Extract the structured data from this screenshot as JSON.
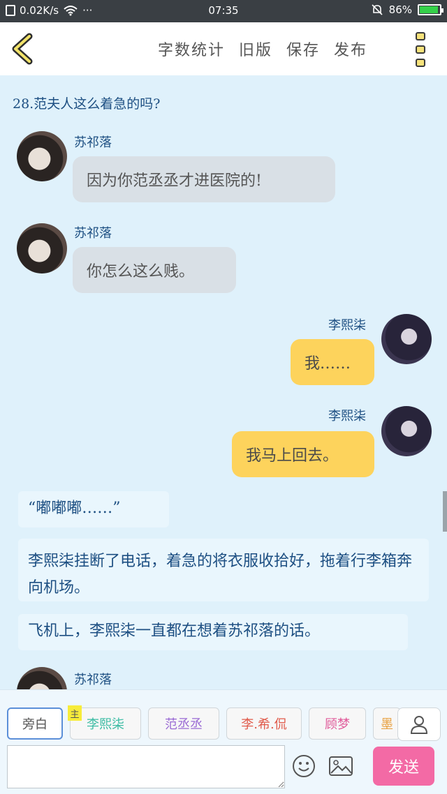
{
  "status_bar": {
    "speed": "0.02K/s",
    "more": "···",
    "time": "07:35",
    "battery_text": "86%",
    "battery_level": 0.86
  },
  "toolbar": {
    "word_count": "字数统计",
    "old_version": "旧版",
    "save": "保存",
    "publish": "发布"
  },
  "chat": {
    "chapter_title": "28.范夫人这么着急的吗?",
    "messages": [
      {
        "side": "left",
        "name": "苏祁落",
        "text": "因为你范丞丞才进医院的!"
      },
      {
        "side": "left",
        "name": "苏祁落",
        "text": "你怎么这么贱。"
      },
      {
        "side": "right",
        "name": "李熙柒",
        "text": "我……"
      },
      {
        "side": "right",
        "name": "李熙柒",
        "text": "我马上回去。"
      }
    ],
    "narrations": [
      "“嘟嘟嘟……”",
      "李熙柒挂断了电话，着急的将衣服收拾好，拖着行李箱奔向机场。",
      "飞机上，李熙柒一直都在想着苏祁落的话。"
    ],
    "partial_name": "苏祁落"
  },
  "characters": {
    "narrator": "旁白",
    "main_tag": "主",
    "list": [
      "李熙柒",
      "范丞丞",
      "李.希.侃",
      "顾梦",
      "墨"
    ]
  },
  "composer": {
    "placeholder": "",
    "send_label": "发送"
  },
  "colors": {
    "background": "#dff1fb",
    "yellow_bubble": "#fdd35c",
    "gray_bubble": "#d9e0e6",
    "send": "#f36aa5",
    "accent_text": "#1d4f82"
  }
}
